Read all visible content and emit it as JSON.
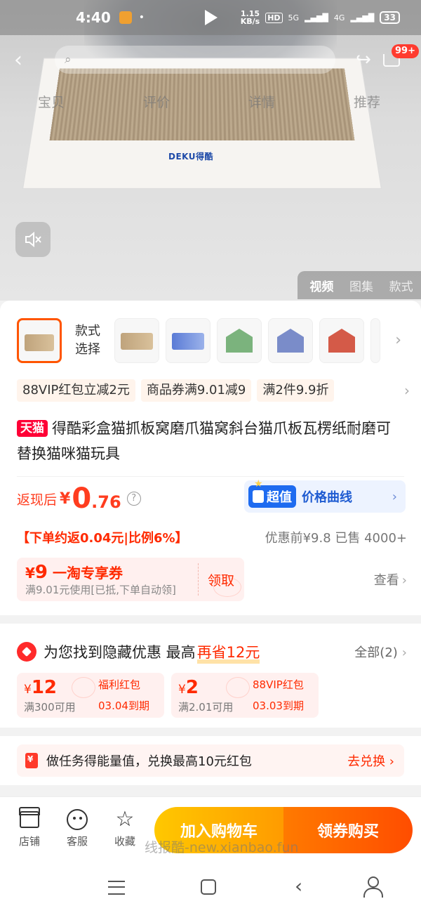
{
  "status_bar": {
    "time": "4:40",
    "net_speed": "1.15",
    "net_unit": "KB/s",
    "hd": "HD",
    "sig1": "5G",
    "sig2": "4G",
    "battery": "33"
  },
  "nav": {
    "back_icon": "back-arrow-icon",
    "search_placeholder": "",
    "share_icon": "share-icon",
    "cart_badge": "99+"
  },
  "tabs": [
    "宝贝",
    "评价",
    "详情",
    "推荐"
  ],
  "media": {
    "brand_print": "DEKU得酷",
    "switch": [
      "视频",
      "图集",
      "款式"
    ],
    "active_switch": "视频"
  },
  "variants": {
    "label": "款式\n选择",
    "label_lines": [
      "款式",
      "选择"
    ],
    "count": 7
  },
  "promos": [
    "88VIP红包立减2元",
    "商品券满9.01减9",
    "满2件9.9折"
  ],
  "product": {
    "badge": "天猫",
    "title": "得酷彩盒猫抓板窝磨爪猫窝斜台猫爪板瓦楞纸耐磨可替换猫咪猫玩具"
  },
  "price": {
    "prefix": "返现后",
    "currency": "¥",
    "integer": "0",
    "decimal": ".76",
    "help": "?"
  },
  "price_curve": {
    "logo": "超值",
    "label": "价格曲线"
  },
  "cashback": "【下单约返0.04元|比例6%】",
  "sold": "优惠前¥9.8  已售 4000+",
  "coupon": {
    "currency": "¥",
    "amount": "9",
    "title": "一淘专享券",
    "condition": "满9.01元使用[已抵,下单自动领]",
    "claim": "领取"
  },
  "view_label": "查看",
  "hidden_deals": {
    "title": "为您找到隐藏优惠  最高",
    "save": "再省12元",
    "all": "全部(2)",
    "packs": [
      {
        "currency": "¥",
        "amount": "12",
        "condition": "满300可用",
        "name": "福利红包",
        "expiry": "03.04到期"
      },
      {
        "currency": "¥",
        "amount": "2",
        "condition": "满2.01可用",
        "name": "88VIP红包",
        "expiry": "03.03到期"
      }
    ]
  },
  "task": {
    "text": "做任务得能量值，兑换最高10元红包",
    "action": "去兑换 ›"
  },
  "action_bar": {
    "shop": "店铺",
    "service": "客服",
    "favorite": "收藏",
    "add_cart": "加入购物车",
    "buy": "领券购买"
  },
  "watermark": "线报酷-new.xianbao.fun"
}
